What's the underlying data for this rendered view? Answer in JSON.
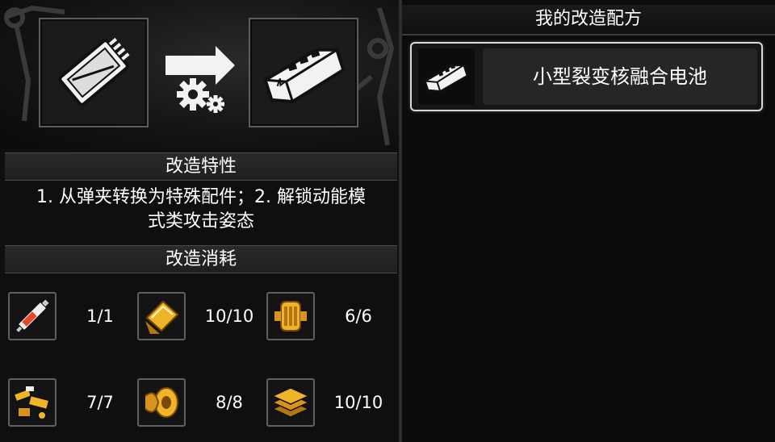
{
  "conversion": {
    "source_icon": "magazine-icon",
    "target_icon": "battery-icon",
    "arrow_icon": "gear-arrow-icon"
  },
  "traits": {
    "title": "改造特性",
    "text_line1": "1. 从弹夹转换为特殊配件；2. 解锁动能模",
    "text_line2": "式类攻击姿态"
  },
  "cost": {
    "title": "改造消耗",
    "materials": [
      {
        "icon": "syringe-part-icon",
        "count": "1/1"
      },
      {
        "icon": "gold-plate-icon",
        "count": "10/10"
      },
      {
        "icon": "gold-engine-icon",
        "count": "6/6"
      },
      {
        "icon": "gold-parts-pile-icon",
        "count": "7/7"
      },
      {
        "icon": "gold-spring-icon",
        "count": "8/8"
      },
      {
        "icon": "gold-ingot-stack-icon",
        "count": "10/10"
      }
    ]
  },
  "recipes": {
    "title": "我的改造配方",
    "items": [
      {
        "icon": "battery-icon",
        "name": "小型裂变核融合电池"
      }
    ]
  },
  "colors": {
    "gold": "#f0b429",
    "gold_dark": "#b37512",
    "panel_border": "#5d5d5d",
    "selected_border": "#d8d8d8"
  }
}
